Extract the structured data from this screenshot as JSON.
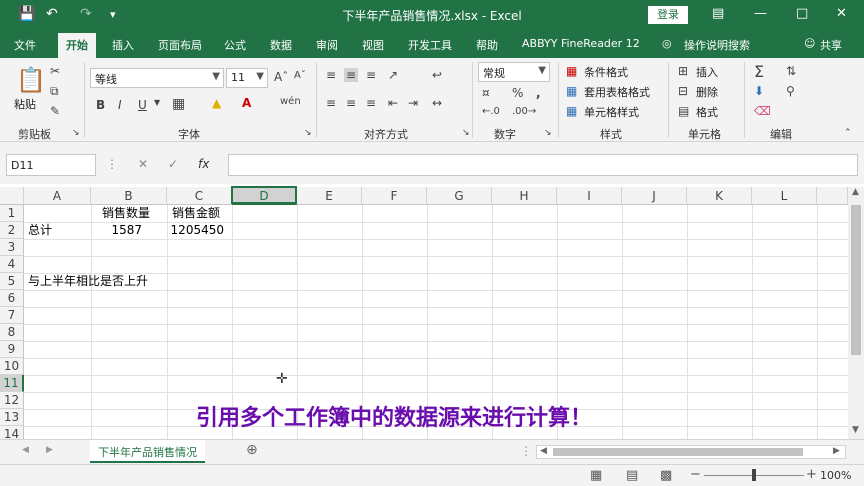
{
  "window": {
    "title": "下半年产品销售情况.xlsx  -  Excel",
    "login_label": "登录"
  },
  "tabs": [
    "文件",
    "开始",
    "插入",
    "页面布局",
    "公式",
    "数据",
    "审阅",
    "视图",
    "开发工具",
    "帮助",
    "ABBYY FineReader 12"
  ],
  "tell_me": "操作说明搜索",
  "share": "共享",
  "ribbon": {
    "clipboard": {
      "paste": "粘贴",
      "label": "剪贴板"
    },
    "font": {
      "name": "等线",
      "size": "11",
      "label": "字体"
    },
    "alignment": {
      "label": "对齐方式"
    },
    "number": {
      "format": "常规",
      "label": "数字"
    },
    "styles": {
      "conditional": "条件格式",
      "table": "套用表格格式",
      "cell": "单元格样式",
      "label": "样式"
    },
    "cells": {
      "insert": "插入",
      "delete": "删除",
      "format": "格式",
      "label": "单元格"
    },
    "editing": {
      "label": "编辑"
    }
  },
  "formula_bar": {
    "name_box": "D11",
    "formula": ""
  },
  "columns": [
    "A",
    "B",
    "C",
    "D",
    "E",
    "F",
    "G",
    "H",
    "I",
    "J",
    "K",
    "L"
  ],
  "rows": [
    "1",
    "2",
    "3",
    "4",
    "5",
    "6",
    "7",
    "8",
    "9",
    "10",
    "11",
    "12",
    "13",
    "14"
  ],
  "cells": {
    "B1": "销售数量",
    "C1": "销售金额",
    "A2": "总计",
    "B2": "1587",
    "C2": "1205450",
    "A5": "与上半年相比是否上升"
  },
  "selected_cell": "D11",
  "sheet_tab": "下半年产品销售情况",
  "zoom": "100%",
  "caption": "引用多个工作簿中的数据源来进行计算！"
}
